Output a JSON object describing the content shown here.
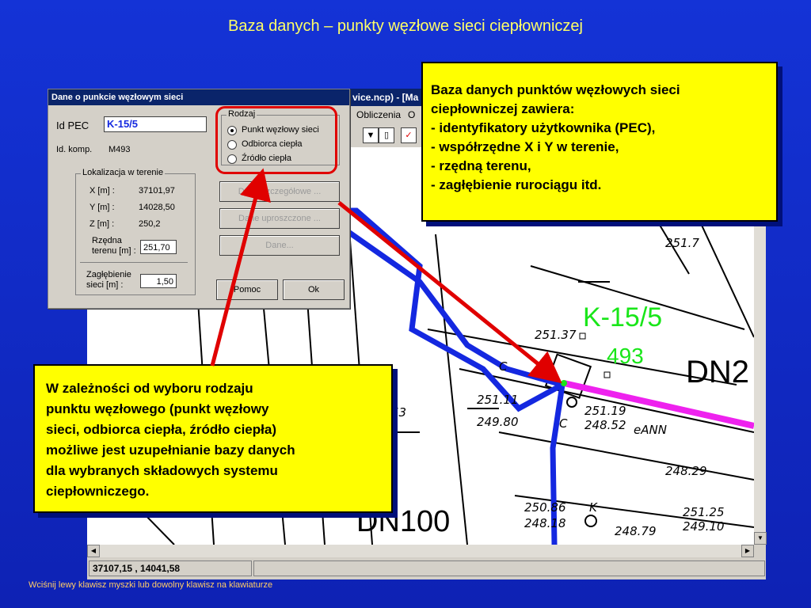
{
  "slide": {
    "title": "Baza danych – punkty węzłowe sieci ciepłowniczej",
    "footer_note": "Wciśnij lewy klawisz myszki lub dowolny klawisz na klawiaturze"
  },
  "app": {
    "title_fragment": "vice.ncp) - [Ma",
    "menu": [
      "Obliczenia",
      "O"
    ],
    "status_coordinates": "37107,15 , 14041,58"
  },
  "map": {
    "node_label": "K-15/5",
    "node_number": "493",
    "pipe_labels": [
      "DN2",
      "DN100"
    ],
    "survey_texts": [
      "251.7",
      "251.37",
      "251.11",
      "249.80",
      "251.19",
      "248.52",
      "eANN",
      "248.29",
      "250.86",
      "248.18",
      "251.25",
      "249.10",
      "248.79",
      "53",
      "K",
      "C",
      "C"
    ],
    "colors": {
      "node_label": "#19e619",
      "pipe_main": "#1428e0",
      "pipe_branch": "#ee22ee"
    }
  },
  "dialog": {
    "title": "Dane o punkcie węzłowym sieci",
    "id_pec_label": "Id PEC",
    "id_pec_value": "K-15/5",
    "id_komp_label": "Id. komp.",
    "id_komp_value": "M493",
    "location_group": "Lokalizacja w terenie",
    "x_label": "X [m] :",
    "x_value": "37101,97",
    "y_label": "Y [m] :",
    "y_value": "14028,50",
    "z_label": "Z [m] :",
    "z_value": "250,2",
    "terrain_label_1": "Rzędna",
    "terrain_label_2": "terenu [m] :",
    "terrain_value": "251,70",
    "depth_label_1": "Zagłębienie",
    "depth_label_2": "sieci [m] :",
    "depth_value": "1,50",
    "type_group": "Rodzaj",
    "type_options": [
      "Punkt węzłowy sieci",
      "Odbiorca ciepła",
      "Źródło ciepła"
    ],
    "type_selected": "Punkt węzłowy sieci",
    "btn_detailed": "Dane szczegółowe ...",
    "btn_simplified": "Dane uproszczone ...",
    "btn_data": "Dane...",
    "btn_help": "Pomoc",
    "btn_ok": "Ok"
  },
  "callout_top": {
    "lines": [
      "Baza danych punktów węzłowych sieci",
      "ciepłowniczej zawiera:",
      "   - identyfikatory użytkownika (PEC),",
      "   - współrzędne X i Y w terenie,",
      "   - rzędną terenu,",
      "   - zagłębienie rurociągu itd."
    ]
  },
  "callout_bottom": {
    "lines": [
      "W zależności od wyboru rodzaju",
      "punktu węzłowego (punkt węzłowy",
      "sieci, odbiorca ciepła, źródło ciepła)",
      "możliwe jest uzupełnianie bazy danych",
      "dla wybranych składowych systemu",
      "ciepłowniczego."
    ]
  }
}
